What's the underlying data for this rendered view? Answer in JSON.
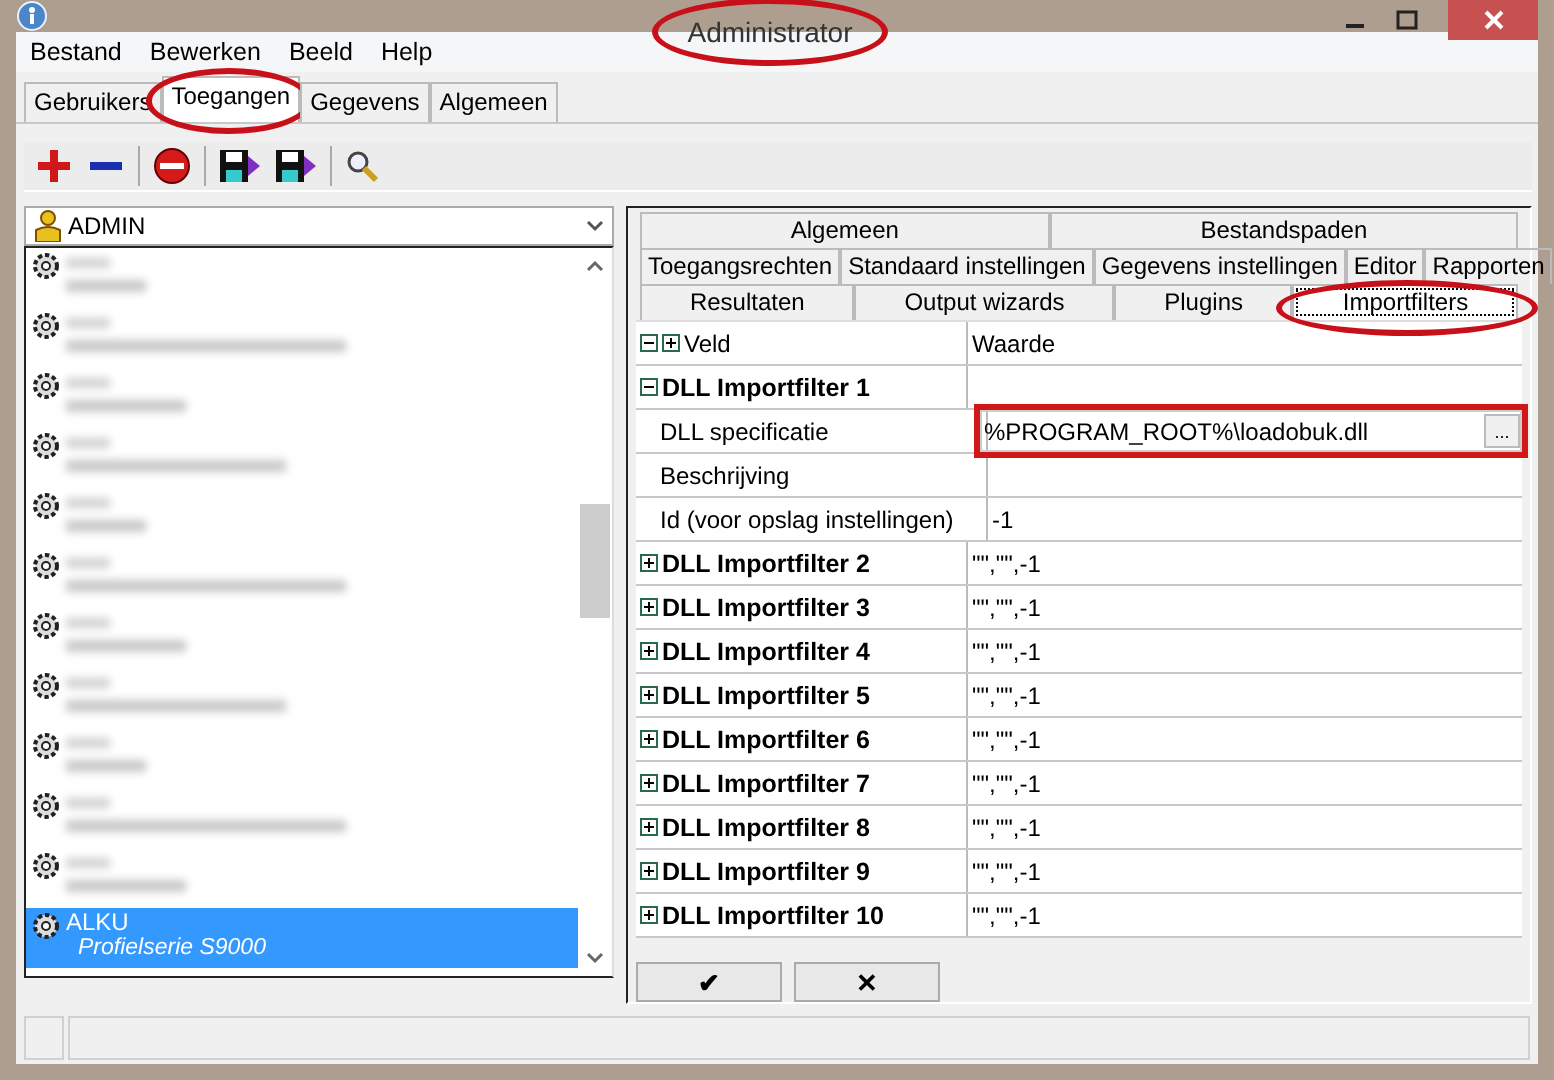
{
  "window": {
    "title": "Administrator",
    "title_marked": true
  },
  "menu": [
    "Bestand",
    "Bewerken",
    "Beeld",
    "Help"
  ],
  "tabs": [
    {
      "label": "Gebruikers",
      "selected": false,
      "marked": false
    },
    {
      "label": "Toegangen",
      "selected": true,
      "marked": true
    },
    {
      "label": "Gegevens",
      "selected": false,
      "marked": false
    },
    {
      "label": "Algemeen",
      "selected": false,
      "marked": false
    }
  ],
  "toolbar": [
    {
      "kind": "add"
    },
    {
      "kind": "remove"
    },
    {
      "kind": "sep"
    },
    {
      "kind": "stop"
    },
    {
      "kind": "sep"
    },
    {
      "kind": "import"
    },
    {
      "kind": "export"
    },
    {
      "kind": "sep"
    },
    {
      "kind": "search"
    }
  ],
  "user_combo": {
    "value": "ADMIN"
  },
  "list": [
    {
      "kind": "blurred",
      "selected": false
    },
    {
      "kind": "blurred",
      "selected": false
    },
    {
      "kind": "blurred",
      "selected": false
    },
    {
      "kind": "blurred",
      "selected": false
    },
    {
      "kind": "blurred",
      "selected": false
    },
    {
      "kind": "blurred",
      "selected": false
    },
    {
      "kind": "blurred",
      "selected": false
    },
    {
      "kind": "blurred",
      "selected": false
    },
    {
      "kind": "blurred",
      "selected": false
    },
    {
      "kind": "blurred",
      "selected": false
    },
    {
      "kind": "blurred",
      "selected": false
    },
    {
      "kind": "text",
      "name": "ALKU",
      "subtitle": "Profielserie S9000",
      "selected": true
    }
  ],
  "settings_tabs": [
    [
      {
        "label": "Algemeen",
        "selected": false,
        "marked": false
      },
      {
        "label": "Bestandspaden",
        "selected": false,
        "marked": false
      }
    ],
    [
      {
        "label": "Toegangsrechten",
        "selected": false,
        "marked": false
      },
      {
        "label": "Standaard instellingen",
        "selected": false,
        "marked": false
      },
      {
        "label": "Gegevens instellingen",
        "selected": false,
        "marked": false
      },
      {
        "label": "Editor",
        "selected": false,
        "marked": false
      },
      {
        "label": "Rapporten",
        "selected": false,
        "marked": false
      }
    ],
    [
      {
        "label": "Resultaten",
        "selected": false,
        "marked": false
      },
      {
        "label": "Output wizards",
        "selected": false,
        "marked": false
      },
      {
        "label": "Plugins",
        "selected": false,
        "marked": false
      },
      {
        "label": "Importfilters",
        "selected": true,
        "marked": true
      }
    ]
  ],
  "grid": {
    "columns": [
      "Veld",
      "Waarde"
    ],
    "rows": [
      {
        "label": "DLL Importfilter 1",
        "expanded": true,
        "children": [
          {
            "label": "DLL specificatie",
            "value": "%PROGRAM_ROOT%\\loadobuk.dll",
            "kind": "file",
            "browse": "...",
            "marked": true
          },
          {
            "label": "Beschrijving",
            "kind": "text"
          },
          {
            "label": "Id (voor opslag instellingen)",
            "value": "-1",
            "kind": "text"
          }
        ]
      },
      {
        "label": "DLL Importfilter 2",
        "expanded": false,
        "value": "\"\",\"\",-1"
      },
      {
        "label": "DLL Importfilter 3",
        "expanded": false,
        "value": "\"\",\"\",-1"
      },
      {
        "label": "DLL Importfilter 4",
        "expanded": false,
        "value": "\"\",\"\",-1"
      },
      {
        "label": "DLL Importfilter 5",
        "expanded": false,
        "value": "\"\",\"\",-1"
      },
      {
        "label": "DLL Importfilter 6",
        "expanded": false,
        "value": "\"\",\"\",-1"
      },
      {
        "label": "DLL Importfilter 7",
        "expanded": false,
        "value": "\"\",\"\",-1"
      },
      {
        "label": "DLL Importfilter 8",
        "expanded": false,
        "value": "\"\",\"\",-1"
      },
      {
        "label": "DLL Importfilter 9",
        "expanded": false,
        "value": "\"\",\"\",-1"
      },
      {
        "label": "DLL Importfilter 10",
        "expanded": false,
        "value": "\"\",\"\",-1"
      }
    ]
  },
  "buttons": [
    "✔",
    "✕"
  ]
}
